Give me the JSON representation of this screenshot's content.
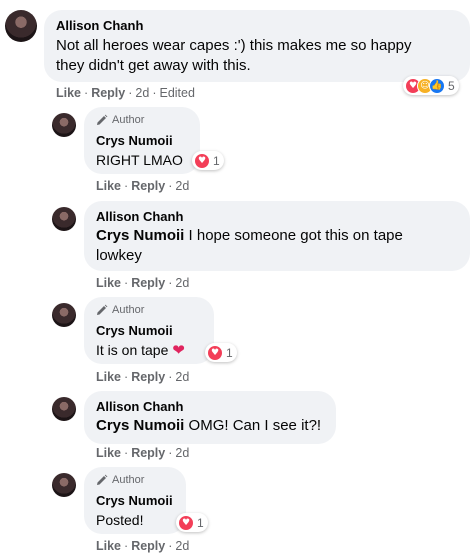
{
  "comments": [
    {
      "name": "Allison Chanh",
      "text_line1": "Not all heroes wear capes :') this makes me so happy",
      "text_line2": "they didn't get away with this.",
      "reaction_count": "5",
      "like": "Like",
      "reply": "Reply",
      "time": "2d",
      "edited": "Edited"
    },
    {
      "author_badge": "Author",
      "name": "Crys Numoii",
      "text": "RIGHT LMAO",
      "reaction_count": "1",
      "like": "Like",
      "reply": "Reply",
      "time": "2d"
    },
    {
      "name": "Allison Chanh",
      "mention": "Crys Numoii",
      "text_line1": " I hope someone got this on tape",
      "text_line2": "lowkey",
      "like": "Like",
      "reply": "Reply",
      "time": "2d"
    },
    {
      "author_badge": "Author",
      "name": "Crys Numoii",
      "text": "It is on tape ",
      "emoji": "❤",
      "reaction_count": "1",
      "like": "Like",
      "reply": "Reply",
      "time": "2d"
    },
    {
      "name": "Allison Chanh",
      "mention": "Crys Numoii",
      "text": " OMG! Can I see it?!",
      "like": "Like",
      "reply": "Reply",
      "time": "2d"
    },
    {
      "author_badge": "Author",
      "name": "Crys Numoii",
      "text": "Posted!",
      "reaction_count": "1",
      "like": "Like",
      "reply": "Reply",
      "time": "2d"
    }
  ],
  "separator": "·",
  "icons": {
    "love": "heart-icon",
    "care": "care-icon",
    "like": "thumbs-up-icon",
    "author": "pencil-icon"
  },
  "colors": {
    "bubble": "#f0f2f5",
    "meta": "#65676b",
    "love": "#f33e58",
    "like": "#1877f2",
    "care": "#f7b125"
  }
}
